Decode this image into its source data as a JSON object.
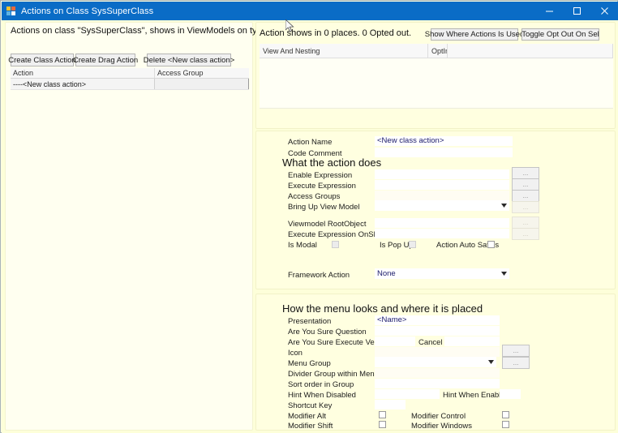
{
  "window": {
    "title": "Actions on Class SysSuperClass",
    "icon": "app-window-icon",
    "minimize_label": "—",
    "maximize_label": "□",
    "close_label": "×",
    "colors": {
      "titlebar": "#0a6cc6",
      "client_bg": "#fdffd9",
      "card_bg": "#ffffe0",
      "panel_bg": "#fffff0",
      "input_text": "#1b1b6b"
    }
  },
  "left_panel": {
    "heading": "Actions on class \"SysSuperClass\", shows in ViewModels on type match",
    "buttons": {
      "create_class_action": "Create Class Action",
      "create_drag_action": "Create Drag Action",
      "delete_action": "Delete <New class action>"
    },
    "grid": {
      "columns": [
        "Action",
        "Access Group"
      ],
      "rows": [
        {
          "action": "----<New class action>",
          "access_group": ""
        }
      ]
    }
  },
  "usage_card": {
    "heading": "Action shows in 0 places. 0 Opted out.",
    "buttons": {
      "show_where_used": "Show Where Actions Is Used",
      "toggle_opt_out": "Toggle Opt Out On Sel"
    },
    "grid": {
      "columns": [
        "View And Nesting",
        "Opt In",
        ""
      ],
      "opt_in_line1": "Opt",
      "opt_in_line2": "In",
      "rows": []
    }
  },
  "action_card": {
    "action_name_label": "Action Name",
    "action_name_value": "<New class action>",
    "code_comment_label": "Code Comment",
    "code_comment_value": "",
    "section_title": "What the action does",
    "enable_expression_label": "Enable Expression",
    "enable_expression_value": "",
    "execute_expression_label": "Execute Expression",
    "execute_expression_value": "",
    "access_groups_label": "Access Groups",
    "access_groups_value": "",
    "bring_up_view_model_label": "Bring Up View Model",
    "bring_up_view_model_value": "",
    "viewmodel_rootobject_label": "Viewmodel RootObject",
    "viewmodel_rootobject_value": "",
    "execute_expression_onshow_label": "Execute Expression OnShow",
    "execute_expression_onshow_value": "",
    "is_modal_label": "Is Modal",
    "is_modal_checked": false,
    "is_popup_label": "Is Pop Up",
    "is_popup_checked": false,
    "action_auto_saves_label": "Action Auto Saves",
    "action_auto_saves_checked": false,
    "framework_action_label": "Framework Action",
    "framework_action_value": "None",
    "browse_label": "..."
  },
  "menu_card": {
    "section_title": "How the menu looks and where it is placed",
    "presentation_label": "Presentation",
    "presentation_value": "<Name>",
    "are_you_sure_question_label": "Are You Sure Question",
    "are_you_sure_question_value": "",
    "are_you_sure_execute_verb_label": "Are You Sure Execute Verb",
    "are_you_sure_execute_verb_value": "",
    "cancel_label": "Cancel",
    "cancel_value": "",
    "icon_label": "Icon",
    "icon_value": "",
    "menu_group_label": "Menu Group",
    "menu_group_value": "",
    "divider_group_label": "Divider Group within Menu",
    "divider_group_value": "",
    "sort_order_label": "Sort order in Group",
    "sort_order_value": "",
    "hint_when_disabled_label": "Hint When Disabled",
    "hint_when_disabled_value": "",
    "hint_when_enabled_label": "Hint When Enabled",
    "hint_when_enabled_value": "",
    "shortcut_key_label": "Shortcut Key",
    "shortcut_key_value": "",
    "modifier_alt_label": "Modifier Alt",
    "modifier_alt_checked": false,
    "modifier_control_label": "Modifier Control",
    "modifier_control_checked": false,
    "modifier_shift_label": "Modifier Shift",
    "modifier_shift_checked": false,
    "modifier_windows_label": "Modifier Windows",
    "modifier_windows_checked": false,
    "browse_label": "..."
  }
}
